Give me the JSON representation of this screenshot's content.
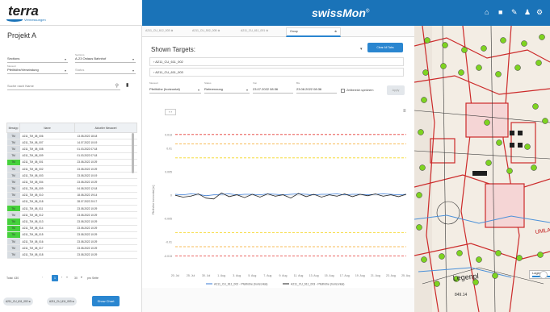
{
  "header": {
    "logo_word": "terra",
    "logo_tagline": "Vermessungen",
    "brand": "swissMon",
    "brand_mark": "®"
  },
  "left": {
    "project_title": "Projekt A",
    "fields": [
      {
        "label": "",
        "value": "Sections"
      },
      {
        "label": "Sections",
        "value": "A-23 Ostaus Bahnhof"
      },
      {
        "label": "Messart",
        "value": "Pfeilhöhe/Verwindung"
      },
      {
        "label": "",
        "value": "Status"
      }
    ],
    "search_placeholder": "Suche nach Name",
    "table": {
      "headers": [
        "Messtyp",
        "Name",
        "Aktueller Messwert"
      ],
      "rows": [
        {
          "t": "TM",
          "n": "A211_TM_08_006",
          "d": "13.08.2022 18:18",
          "on": false
        },
        {
          "t": "TM",
          "n": "A211_TM_08_007",
          "d": "14.07.2022 10:19",
          "on": false
        },
        {
          "t": "TM",
          "n": "A211_TM_08_008",
          "d": "01.03.2022 07:18",
          "on": false
        },
        {
          "t": "TM",
          "n": "A211_TM_08_009",
          "d": "01.03.2022 07:18",
          "on": false
        },
        {
          "t": "TM",
          "n": "A211_TM_08_001",
          "d": "23.08.2022 10:29",
          "on": true
        },
        {
          "t": "TM",
          "n": "A211_TM_08_002",
          "d": "23.08.2022 10:29",
          "on": false
        },
        {
          "t": "TM",
          "n": "A211_TM_08_003",
          "d": "23.08.2022 10:19",
          "on": false
        },
        {
          "t": "TM",
          "n": "A211_TM_08_004",
          "d": "23.08.2022 10:29",
          "on": false
        },
        {
          "t": "TM",
          "n": "A211_TM_08_009",
          "d": "04.08.2022 12:18",
          "on": false
        },
        {
          "t": "TM",
          "n": "A211_TM_08_010",
          "d": "18.08.2022 19:14",
          "on": false
        },
        {
          "t": "TM",
          "n": "A211_TM_08_018",
          "d": "28.07.2022 20:17",
          "on": false
        },
        {
          "t": "TM",
          "n": "A211_TM_08_011",
          "d": "23.08.2022 10:29",
          "on": true
        },
        {
          "t": "TM",
          "n": "A211_TM_08_012",
          "d": "23.08.2022 10:29",
          "on": false
        },
        {
          "t": "TM",
          "n": "A211_TM_08_013",
          "d": "23.08.2022 10:29",
          "on": true
        },
        {
          "t": "TM",
          "n": "A211_TM_08_014",
          "d": "23.08.2022 10:29",
          "on": true
        },
        {
          "t": "TM",
          "n": "A211_TM_08_015",
          "d": "23.08.2022 10:29",
          "on": true
        },
        {
          "t": "TM",
          "n": "A211_TM_08_016",
          "d": "23.08.2022 10:29",
          "on": false
        },
        {
          "t": "TM",
          "n": "A211_TM_08_017",
          "d": "23.08.2022 10:29",
          "on": false
        },
        {
          "t": "TM",
          "n": "A211_TM_08_018",
          "d": "23.08.2022 10:29",
          "on": false
        }
      ]
    },
    "pagination": {
      "total": "Total: 430",
      "current": "1",
      "per_page": "30",
      "per_page_label": "pro Seite"
    },
    "chips": [
      "A211_CU_611_002",
      "A211_CU_611_003"
    ],
    "show_chart": "Show Chart"
  },
  "mid": {
    "tabs": [
      "A211_CU_612_003",
      "A211_CU_502_005",
      "A211_CU_611_001",
      "Group"
    ],
    "shown_targets": "Shown Targets:",
    "clear_all": "Clear All Tabs",
    "targets": [
      "A211_CU_611_002",
      "A211_CU_611_003"
    ],
    "filters": [
      {
        "label": "Messart",
        "value": "Pfeilhöhe (horizontal)"
      },
      {
        "label": "Status",
        "value": "Referenzung"
      },
      {
        "label": "Von",
        "value": "23.07.2022 08:36"
      },
      {
        "label": "Bis",
        "value": "23.08.2022 08:36"
      }
    ],
    "save_range": "Zeitbereich speichern",
    "apply": "Apply"
  },
  "chart_data": {
    "type": "line",
    "ylabel": "Pfeilhöhe horizontal [m]",
    "ylim": [
      -0.016,
      0.014
    ],
    "yticks": [
      0.013,
      0.01,
      0.005,
      0,
      -0.005,
      -0.01,
      -0.013
    ],
    "xticks": [
      "20. Jul",
      "25. Jul",
      "30. Jul",
      "1. Aug",
      "3. Aug",
      "5. Aug",
      "7. Aug",
      "9. Aug",
      "11. Aug",
      "13. Aug",
      "15. Aug",
      "17. Aug",
      "19. Aug",
      "21. Aug",
      "23. Aug",
      "25. Aug"
    ],
    "thresholds": [
      {
        "value": 0.013,
        "color": "#e53935"
      },
      {
        "value": 0.011,
        "color": "#f5a623"
      },
      {
        "value": 0.008,
        "color": "#f5d623"
      },
      {
        "value": -0.008,
        "color": "#f5d623"
      },
      {
        "value": -0.011,
        "color": "#f5a623"
      },
      {
        "value": -0.013,
        "color": "#e53935"
      }
    ],
    "series": [
      {
        "name": "A211_CU_611_002 - Pfeilhöhe (horizontal)",
        "color": "#3a7bd5",
        "values": [
          0.0002,
          0.0001,
          0.0003,
          0.0002,
          -0.0001,
          0.0001,
          0.0002,
          0.0003,
          0.0001,
          0.0002,
          0.0002,
          0.0001,
          0.0003,
          0.0002,
          0.0001,
          0.0002,
          0.0003,
          0.0002,
          0.0001,
          0.0002,
          0.0002,
          0.0003,
          0.0001,
          0.0002,
          0.0002,
          0.0001,
          0.0002,
          0.0003,
          0.0002,
          0.0001,
          0.0002
        ]
      },
      {
        "name": "A211_CU_611_003 - Pfeilhöhe (horizontal)",
        "color": "#222222",
        "values": [
          0.0,
          -0.0004,
          -0.0002,
          0.0003,
          -0.0006,
          -0.0008,
          0.0005,
          -0.0003,
          0.0001,
          -0.0005,
          0.0002,
          -0.0004,
          0.0003,
          -0.0002,
          0.0001,
          -0.0006,
          0.0004,
          -0.0003,
          0.0002,
          -0.0004,
          0.0001,
          -0.0002,
          0.0003,
          -0.0003,
          0.0002,
          -0.0001,
          0.0003,
          -0.0002,
          0.0001,
          -0.0003,
          0.0002
        ]
      }
    ]
  },
  "map": {
    "label": "UMLA",
    "label2": "Legenpl",
    "legend": "Lageplan",
    "km": "849.14"
  }
}
